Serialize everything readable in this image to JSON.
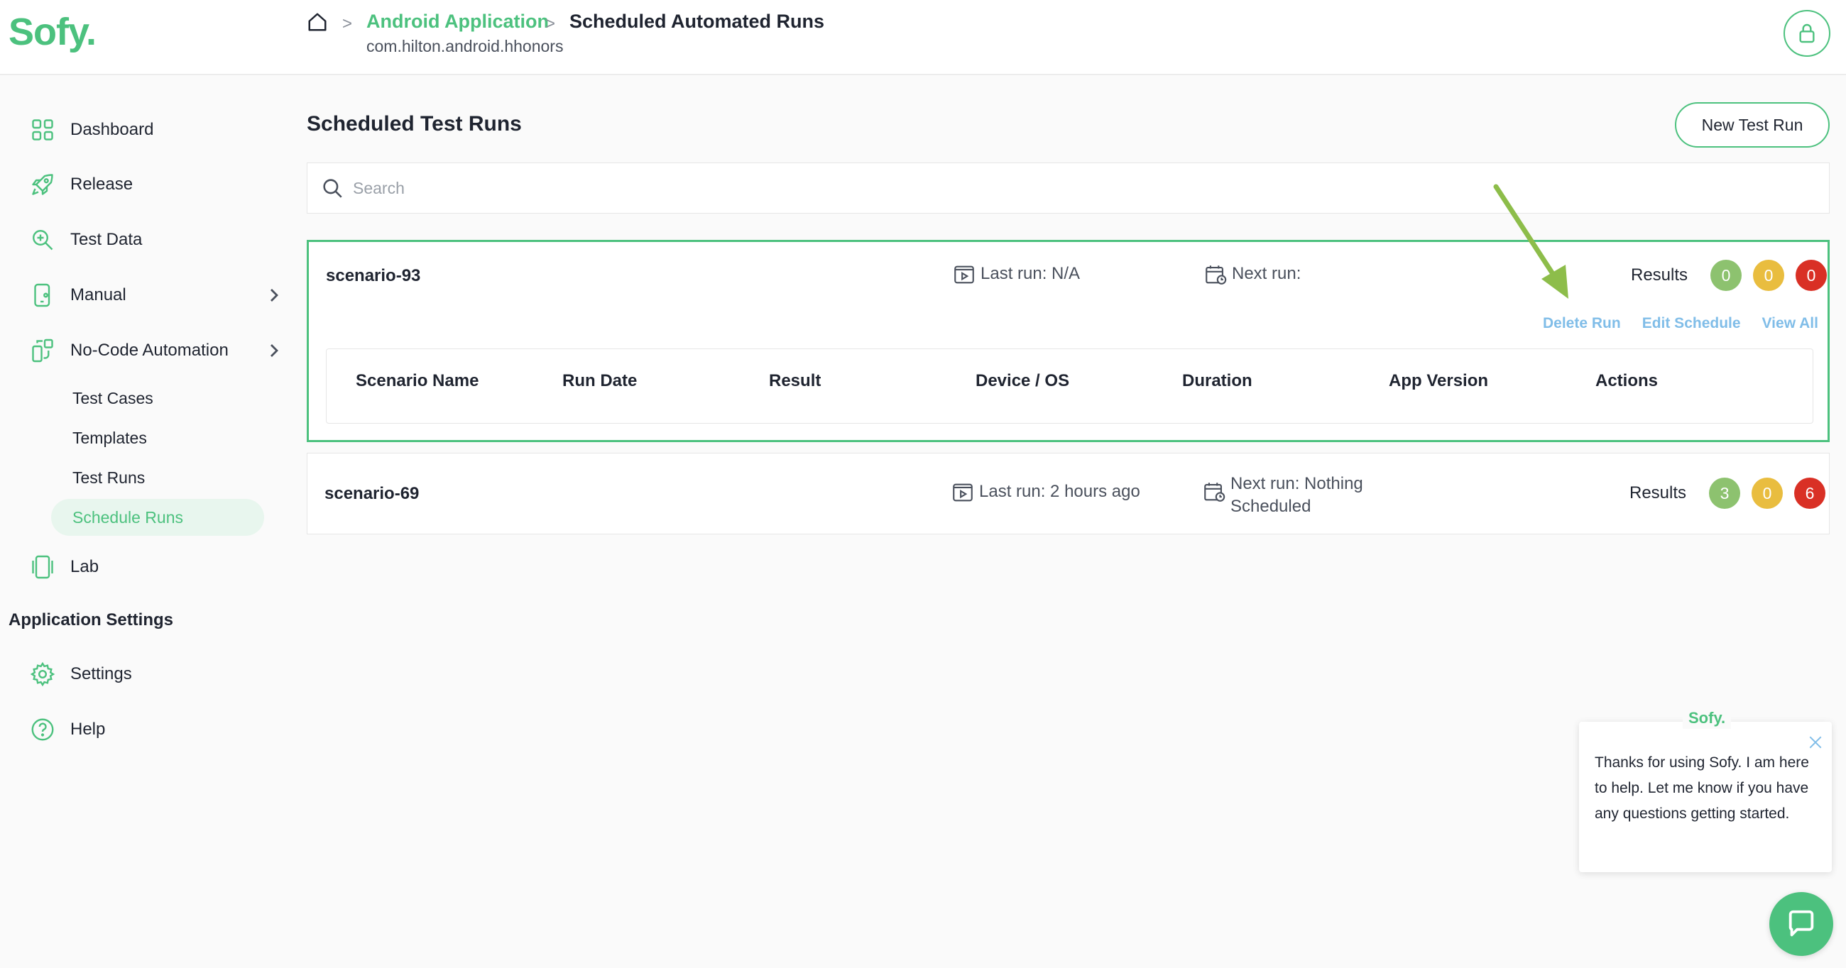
{
  "header": {
    "logo": "Sofy.",
    "breadcrumb": {
      "separator": ">",
      "app": "Android Application",
      "current": "Scheduled Automated Runs",
      "package": "com.hilton.android.hhonors"
    },
    "icons": {
      "home": "home-icon",
      "avatar": "lock-avatar-icon"
    }
  },
  "sidebar": {
    "items": [
      {
        "label": "Dashboard",
        "icon": "dashboard-grid-icon"
      },
      {
        "label": "Release",
        "icon": "rocket-icon"
      },
      {
        "label": "Test Data",
        "icon": "test-data-search-icon"
      },
      {
        "label": "Manual",
        "icon": "phone-touch-icon"
      },
      {
        "label": "No-Code Automation",
        "icon": "automation-icon"
      }
    ],
    "sub_items": [
      "Test Cases",
      "Templates",
      "Test Runs",
      "Schedule Runs"
    ],
    "active_sub": "Schedule Runs",
    "lab": {
      "label": "Lab",
      "icon": "device-lab-icon"
    },
    "section_title": "Application Settings",
    "settings_items": [
      {
        "label": "Settings",
        "icon": "gear-icon"
      },
      {
        "label": "Help",
        "icon": "help-icon"
      }
    ]
  },
  "main": {
    "title": "Scheduled Test Runs",
    "new_run_button": "New Test Run",
    "search": {
      "placeholder": "Search",
      "value": ""
    },
    "cards": [
      {
        "name": "scenario-93",
        "last_run": "Last run: N/A",
        "next_run_1": "Next run:",
        "next_run_2": "",
        "results_label": "Results",
        "results": {
          "passed": "0",
          "warning": "0",
          "failed": "0"
        },
        "links": [
          "Delete Run",
          "Edit Schedule",
          "View All"
        ],
        "table_headers": [
          "Scenario Name",
          "Run Date",
          "Result",
          "Device / OS",
          "Duration",
          "App Version",
          "Actions"
        ]
      },
      {
        "name": "scenario-69",
        "last_run": "Last run: 2 hours ago",
        "next_run_1": "Next run: Nothing",
        "next_run_2": "Scheduled",
        "results_label": "Results",
        "results": {
          "passed": "3",
          "warning": "0",
          "failed": "6"
        }
      }
    ]
  },
  "chat": {
    "brand": "Sofy.",
    "message": "Thanks for using Sofy. I am here to help. Let me know if you have any questions getting started."
  },
  "colors": {
    "brand_green": "#4cc17e",
    "passed": "#8dc26f",
    "warning": "#e9bd3f",
    "failed": "#d93025",
    "link_blue": "#80bde8",
    "annotation_arrow": "#8dbd4a"
  }
}
